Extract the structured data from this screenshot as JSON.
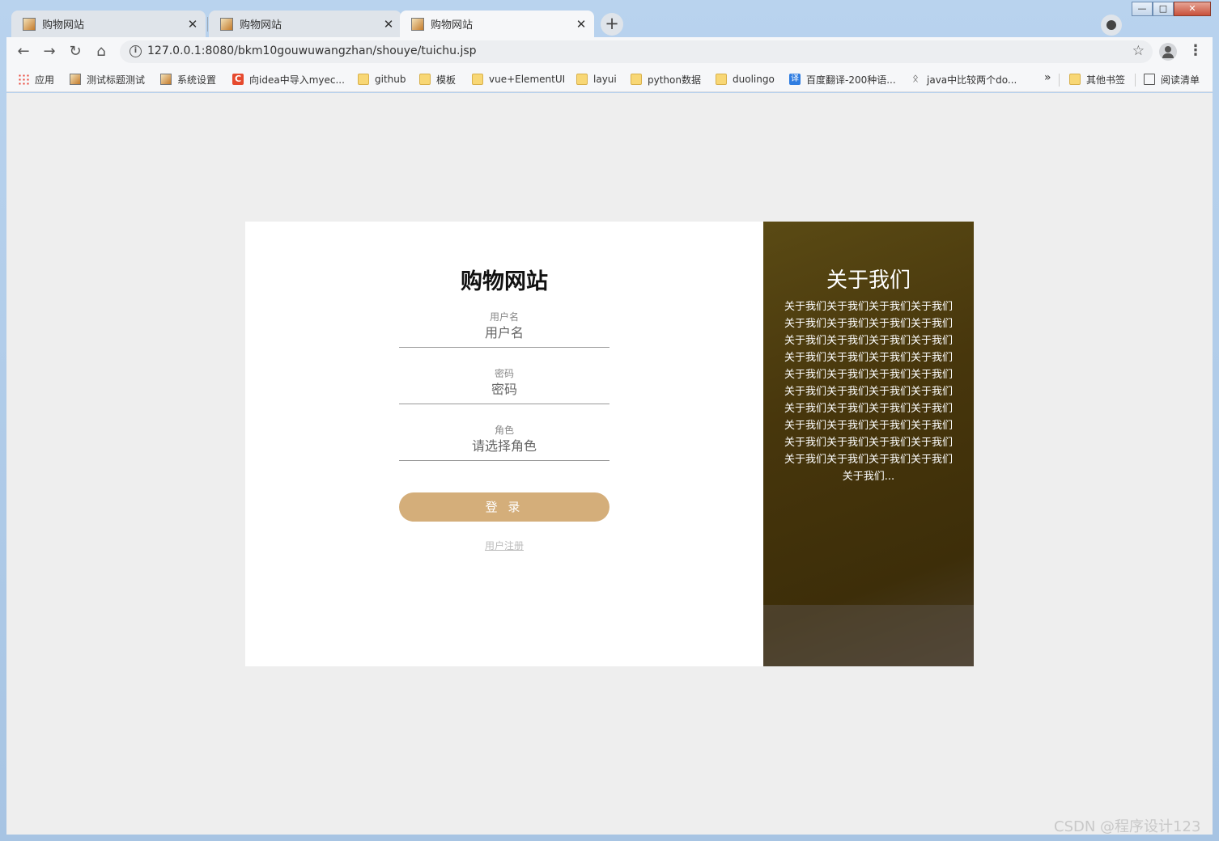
{
  "browser": {
    "tabs": [
      {
        "label": "购物网站",
        "active": false
      },
      {
        "label": "购物网站",
        "active": false
      },
      {
        "label": "购物网站",
        "active": true
      }
    ],
    "url": "127.0.0.1:8080/bkm10gouwuwangzhan/shouye/tuichu.jsp",
    "bookmarks": [
      {
        "label": "应用",
        "icon": "apps-icon"
      },
      {
        "label": "测试标题测试",
        "icon": "page-icon"
      },
      {
        "label": "系统设置",
        "icon": "page-icon"
      },
      {
        "label": "向idea中导入myec...",
        "icon": "csdn-icon"
      },
      {
        "label": "github",
        "icon": "folder-icon"
      },
      {
        "label": "模板",
        "icon": "folder-icon"
      },
      {
        "label": "vue+ElementUI",
        "icon": "folder-icon"
      },
      {
        "label": "layui",
        "icon": "folder-icon"
      },
      {
        "label": "python数据",
        "icon": "folder-icon"
      },
      {
        "label": "duolingo",
        "icon": "folder-icon"
      },
      {
        "label": "百度翻译-200种语...",
        "icon": "translate-icon"
      },
      {
        "label": "java中比较两个do...",
        "icon": "java-icon"
      },
      {
        "label": "其他书签",
        "icon": "folder-icon"
      },
      {
        "label": "阅读清单",
        "icon": "reading-list-icon"
      }
    ],
    "more_bookmarks": "»"
  },
  "login": {
    "title": "购物网站",
    "username": {
      "label": "用户名",
      "placeholder": "用户名"
    },
    "password": {
      "label": "密码",
      "placeholder": "密码"
    },
    "role": {
      "label": "角色",
      "selected": "请选择角色"
    },
    "login_button": "登 录",
    "register_link": "用户注册"
  },
  "about": {
    "title": "关于我们",
    "text": "关于我们关于我们关于我们关于我们关于我们关于我们关于我们关于我们关于我们关于我们关于我们关于我们关于我们关于我们关于我们关于我们关于我们关于我们关于我们关于我们关于我们关于我们关于我们关于我们关于我们关于我们关于我们关于我们关于我们关于我们关于我们关于我们关于我们关于我们关于我们关于我们关于我们关于我们关于我们关于我们关于我们..."
  },
  "watermark": "CSDN @程序设计123"
}
